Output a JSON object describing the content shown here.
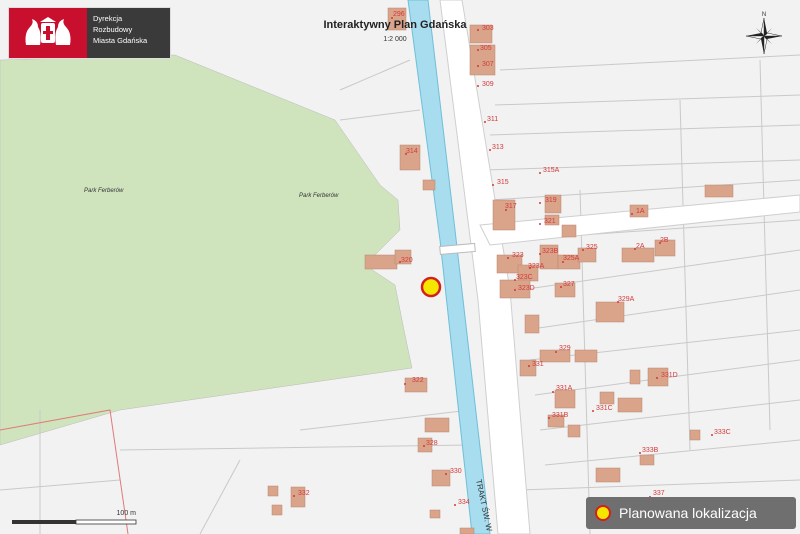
{
  "logo": {
    "line1": "Dyrekcja",
    "line2": "Rozbudowy",
    "line3": "Miasta Gdańska"
  },
  "map": {
    "title": "Interaktywny Plan Gdańska",
    "scale": "1:2 000"
  },
  "areas": {
    "park1": "Park Ferberów",
    "park2": "Park Ferberów"
  },
  "street": "TRAKT ŚW. W",
  "house_numbers": [
    "296",
    "303",
    "305",
    "307",
    "309",
    "311",
    "313",
    "314",
    "315",
    "315A",
    "317",
    "319",
    "320",
    "321",
    "322",
    "323",
    "323A",
    "323B",
    "323C",
    "323D",
    "325",
    "325A",
    "327",
    "328",
    "329",
    "329A",
    "330",
    "331",
    "331A",
    "331B",
    "331C",
    "331D",
    "332",
    "333B",
    "333C",
    "334",
    "337",
    "1A",
    "2A",
    "2B"
  ],
  "scalebar": {
    "label": "100 m"
  },
  "legend": {
    "label": "Planowana lokalizacja"
  },
  "compass": {
    "north": "N"
  },
  "colors": {
    "park": "#cfe3bd",
    "canal": "#a8dcef",
    "building": "#d9a48a",
    "labels": "#d33a3a",
    "marker_fill": "#f5e600",
    "marker_stroke": "#d21f1f"
  }
}
